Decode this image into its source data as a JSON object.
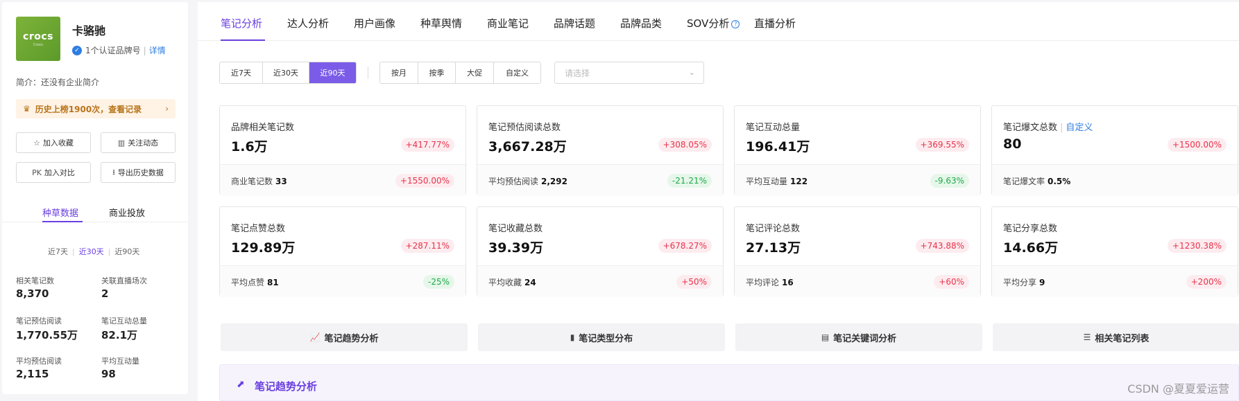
{
  "brand": {
    "logo_text": "crocs",
    "logo_sub": "Crocs",
    "name": "卡骆驰",
    "verified": "1个认证品牌号",
    "detail_link": "详情",
    "intro": "简介：还没有企业简介",
    "history": "历史上榜1900次，查看记录"
  },
  "actions": {
    "favorite": "加入收藏",
    "follow": "关注动态",
    "compare_icon": "PK",
    "compare": "加入对比",
    "export": "导出历史数据"
  },
  "side_tabs": [
    "种草数据",
    "商业投放"
  ],
  "side_range": [
    "近7天",
    "近30天",
    "近90天"
  ],
  "side_stats": [
    {
      "label": "相关笔记数",
      "value": "8,370"
    },
    {
      "label": "关联直播场次",
      "value": "2"
    },
    {
      "label": "笔记预估阅读",
      "value": "1,770.55万"
    },
    {
      "label": "笔记互动总量",
      "value": "82.1万"
    },
    {
      "label": "平均预估阅读",
      "value": "2,115"
    },
    {
      "label": "平均互动量",
      "value": "98"
    }
  ],
  "nav": [
    "笔记分析",
    "达人分析",
    "用户画像",
    "种草舆情",
    "商业笔记",
    "品牌话题",
    "品牌品类",
    "SOV分析",
    "直播分析"
  ],
  "filters": {
    "range": [
      "近7天",
      "近30天",
      "近90天"
    ],
    "period": [
      "按月",
      "按季",
      "大促",
      "自定义"
    ],
    "select_placeholder": "请选择"
  },
  "cards": [
    {
      "title": "品牌相关笔记数",
      "value": "1.6万",
      "change": "+417.77%",
      "sub_label": "商业笔记数",
      "sub_value": "33",
      "sub_change": "+1550.00%"
    },
    {
      "title": "笔记预估阅读总数",
      "value": "3,667.28万",
      "change": "+308.05%",
      "sub_label": "平均预估阅读",
      "sub_value": "2,292",
      "sub_change": "-21.21%"
    },
    {
      "title": "笔记互动总量",
      "value": "196.41万",
      "change": "+369.55%",
      "sub_label": "平均互动量",
      "sub_value": "122",
      "sub_change": "-9.63%"
    },
    {
      "title": "笔记爆文总数",
      "title_link": "自定义",
      "value": "80",
      "change": "+1500.00%",
      "sub_label": "笔记爆文率",
      "sub_value": "0.5%",
      "sub_change": ""
    },
    {
      "title": "笔记点赞总数",
      "value": "129.89万",
      "change": "+287.11%",
      "sub_label": "平均点赞",
      "sub_value": "81",
      "sub_change": "-25%"
    },
    {
      "title": "笔记收藏总数",
      "value": "39.39万",
      "change": "+678.27%",
      "sub_label": "平均收藏",
      "sub_value": "24",
      "sub_change": "+50%"
    },
    {
      "title": "笔记评论总数",
      "value": "27.13万",
      "change": "+743.88%",
      "sub_label": "平均评论",
      "sub_value": "16",
      "sub_change": "+60%"
    },
    {
      "title": "笔记分享总数",
      "value": "14.66万",
      "change": "+1230.38%",
      "sub_label": "平均分享",
      "sub_value": "9",
      "sub_change": "+200%"
    }
  ],
  "sections": [
    "笔记趋势分析",
    "笔记类型分布",
    "笔记关键词分析",
    "相关笔记列表"
  ],
  "trend_title": "笔记趋势分析",
  "watermark": "CSDN @夏夏爱运营",
  "colors": {
    "accent": "#6a3fe0",
    "up": "#e8324b",
    "down": "#1ea84a",
    "link": "#2f7de1"
  }
}
